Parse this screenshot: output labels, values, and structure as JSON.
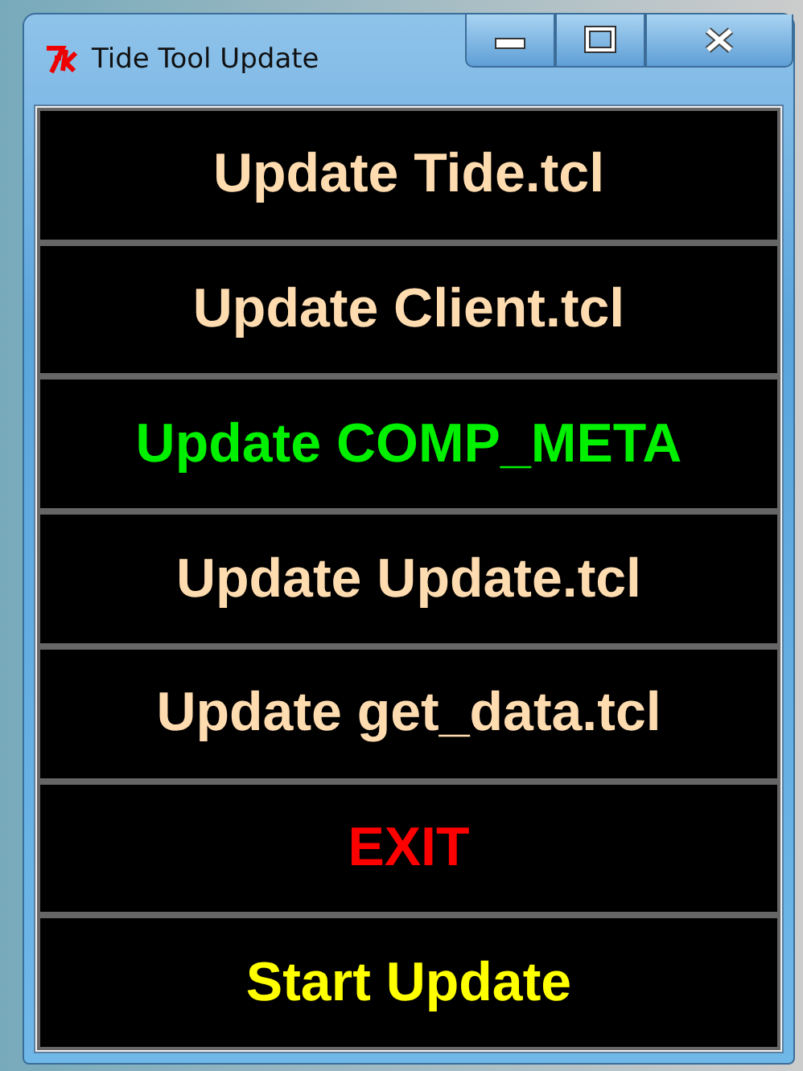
{
  "window": {
    "title": "Tide Tool Update"
  },
  "buttons": [
    {
      "label": "Update Tide.tcl",
      "color": "#ffdcb0"
    },
    {
      "label": "Update Client.tcl",
      "color": "#ffdcb0"
    },
    {
      "label": "Update COMP_META",
      "color": "#00f000"
    },
    {
      "label": "Update Update.tcl",
      "color": "#ffdcb0"
    },
    {
      "label": "Update get_data.tcl",
      "color": "#ffdcb0"
    },
    {
      "label": "EXIT",
      "color": "#ff0000"
    },
    {
      "label": "Start Update",
      "color": "#ffff00"
    }
  ]
}
